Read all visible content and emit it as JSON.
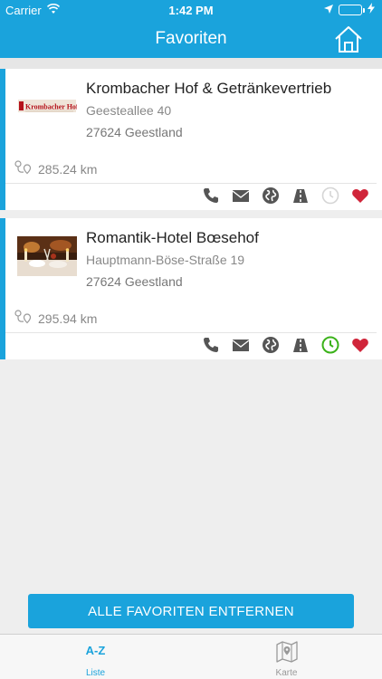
{
  "status": {
    "carrier": "Carrier",
    "time": "1:42 PM"
  },
  "nav": {
    "title": "Favoriten"
  },
  "favorites": [
    {
      "name": "Krombacher Hof & Getränkevertrieb",
      "logo_text": "Krombacher Hof",
      "street": "Geesteallee 40",
      "city": "27624 Geestland",
      "distance": "285.24 km",
      "hours_status": "inactive"
    },
    {
      "name": "Romantik-Hotel Bœsehof",
      "street": "Hauptmann-Böse-Straße 19",
      "city": "27624 Geestland",
      "distance": "295.94 km",
      "hours_status": "open"
    }
  ],
  "actions": {
    "remove_all_label": "ALLE FAVORITEN ENTFERNEN"
  },
  "tabs": [
    {
      "icon_text": "A-Z",
      "label": "Liste"
    },
    {
      "label": "Karte"
    }
  ],
  "colors": {
    "brand": "#1aa3dc",
    "heart": "#d0253a",
    "open_green": "#3bb21a"
  }
}
